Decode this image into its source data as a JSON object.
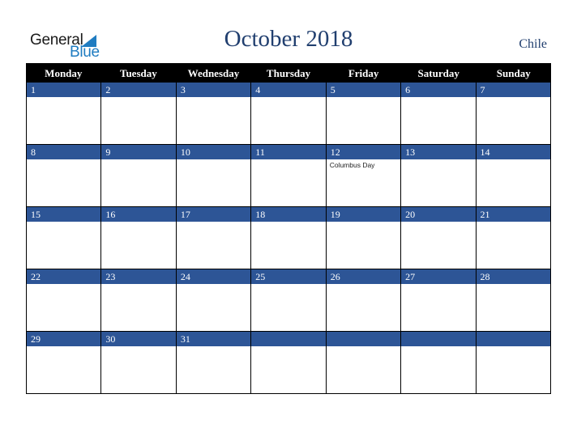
{
  "logo": {
    "word1": "General",
    "word2": "Blue"
  },
  "header": {
    "title": "October 2018",
    "country": "Chile"
  },
  "weekdays": [
    "Monday",
    "Tuesday",
    "Wednesday",
    "Thursday",
    "Friday",
    "Saturday",
    "Sunday"
  ],
  "weeks": [
    [
      {
        "day": "1"
      },
      {
        "day": "2"
      },
      {
        "day": "3"
      },
      {
        "day": "4"
      },
      {
        "day": "5"
      },
      {
        "day": "6"
      },
      {
        "day": "7"
      }
    ],
    [
      {
        "day": "8"
      },
      {
        "day": "9"
      },
      {
        "day": "10"
      },
      {
        "day": "11"
      },
      {
        "day": "12",
        "holiday": "Columbus Day"
      },
      {
        "day": "13"
      },
      {
        "day": "14"
      }
    ],
    [
      {
        "day": "15"
      },
      {
        "day": "16"
      },
      {
        "day": "17"
      },
      {
        "day": "18"
      },
      {
        "day": "19"
      },
      {
        "day": "20"
      },
      {
        "day": "21"
      }
    ],
    [
      {
        "day": "22"
      },
      {
        "day": "23"
      },
      {
        "day": "24"
      },
      {
        "day": "25"
      },
      {
        "day": "26"
      },
      {
        "day": "27"
      },
      {
        "day": "28"
      }
    ],
    [
      {
        "day": "29"
      },
      {
        "day": "30"
      },
      {
        "day": "31"
      },
      {
        "day": ""
      },
      {
        "day": ""
      },
      {
        "day": ""
      },
      {
        "day": ""
      }
    ]
  ],
  "colors": {
    "band": "#2d5596",
    "header": "#000000",
    "title": "#213f6f",
    "logo_blue": "#1f7cc1"
  }
}
